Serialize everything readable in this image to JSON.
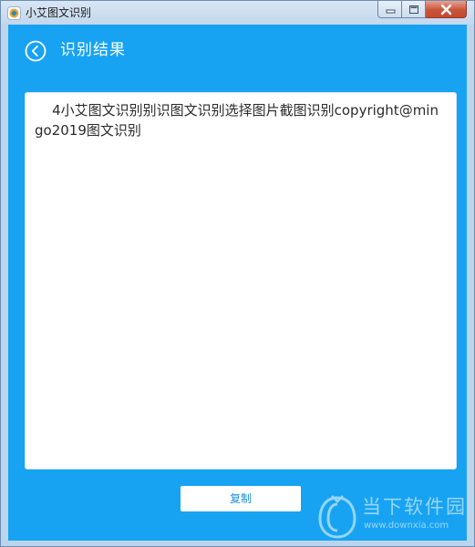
{
  "window": {
    "title": "小艾图文识别"
  },
  "header": {
    "title": "识别结果"
  },
  "result": {
    "text": "    4小艾图文识别别识图文识别选择图片截图识别copyright@mingo2019图文识别"
  },
  "actions": {
    "copy_label": "复制"
  },
  "watermark": {
    "brand": "当下软件园",
    "url": "www.downxia.com"
  },
  "colors": {
    "accent": "#17a3f2",
    "close_button": "#c7553c"
  },
  "icons": {
    "back": "back-arrow-circle-icon",
    "app": "app-logo-icon"
  }
}
